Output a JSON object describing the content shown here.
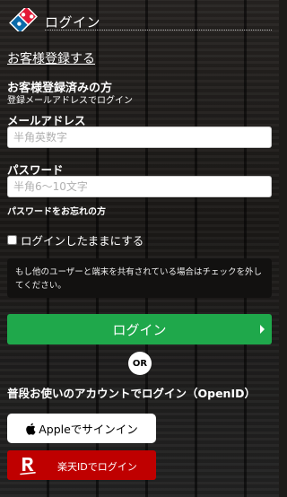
{
  "header": {
    "title": "ログイン"
  },
  "register": {
    "link_label": "お客様登録する"
  },
  "existing": {
    "title": "お客様登録済みの方",
    "subtitle": "登録メールアドレスでログイン"
  },
  "email": {
    "label": "メールアドレス",
    "placeholder": "半角英数字"
  },
  "password": {
    "label": "パスワード",
    "placeholder": "半角6〜10文字"
  },
  "forgot": {
    "label": "パスワードをお忘れの方"
  },
  "keep_logged_in": {
    "label": "ログインしたままにする",
    "checked": false
  },
  "notice": {
    "text": "もし他のユーザーと端末を共有されている場合はチェックを外してください。"
  },
  "login_button": {
    "label": "ログイン"
  },
  "divider": {
    "label": "OR"
  },
  "openid": {
    "title": "普段お使いのアカウントでログイン（OpenID）"
  },
  "apple_button": {
    "label": "Appleでサインイン"
  },
  "rakuten_button": {
    "label": "楽天IDでログイン"
  },
  "colors": {
    "accent_green": "#1fa84b",
    "rakuten_red": "#bf0000",
    "domino_blue": "#0b6aa9",
    "domino_red": "#e31837"
  },
  "icons": [
    "dominos-logo-icon",
    "chevron-right-icon",
    "apple-icon",
    "rakuten-r-icon"
  ]
}
